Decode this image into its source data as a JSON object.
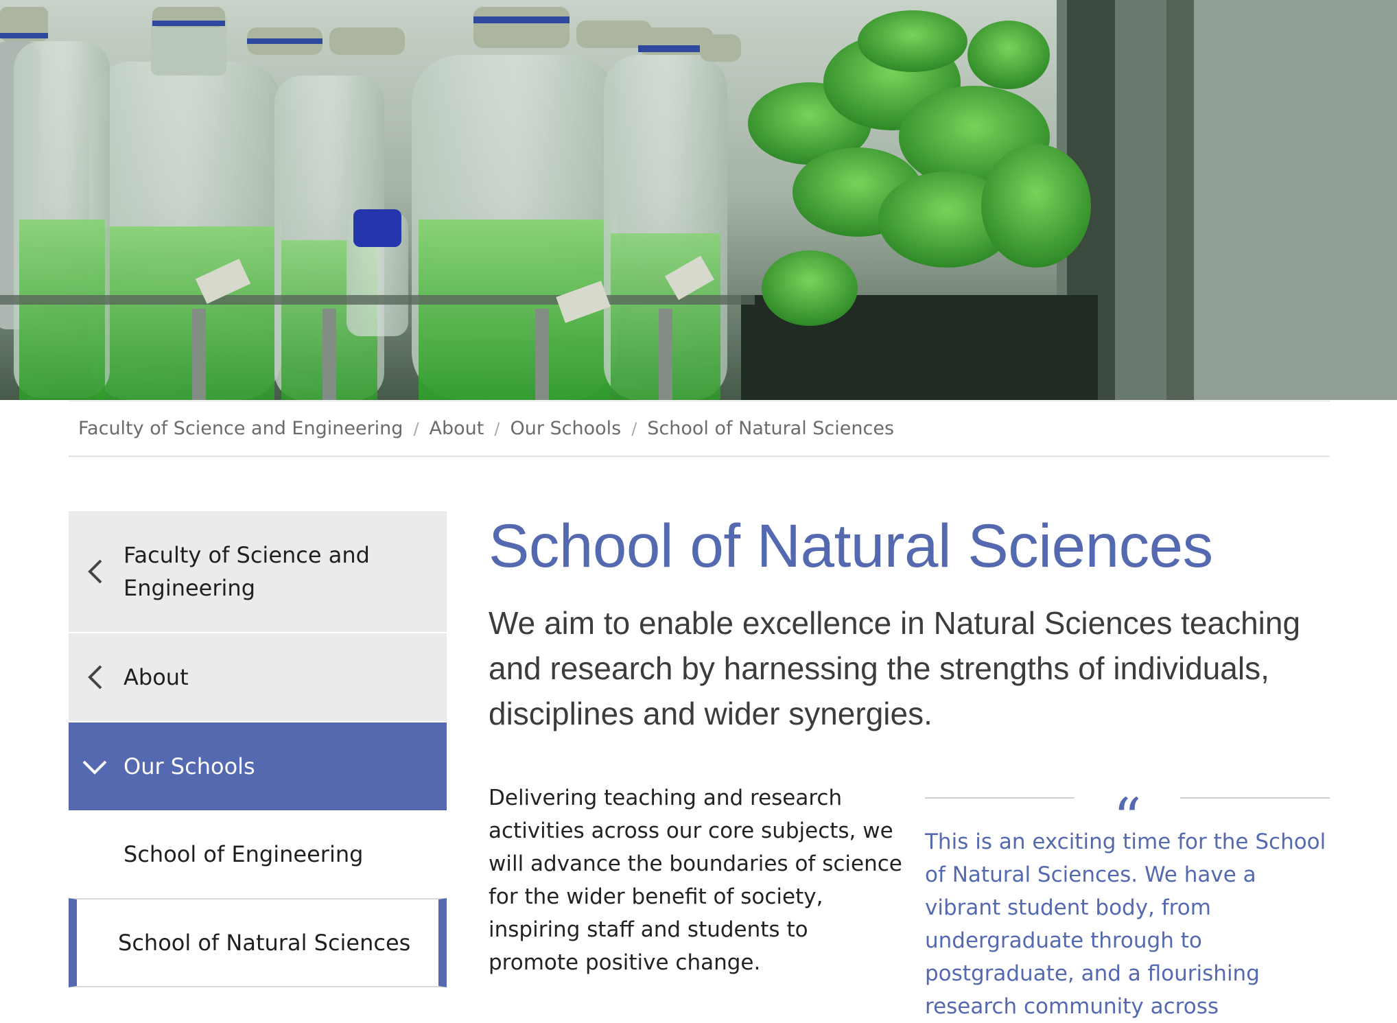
{
  "hero": {
    "image_description_icon": "lab-bottles-plants-image"
  },
  "breadcrumb": {
    "items": [
      "Faculty of Science and Engineering",
      "About",
      "Our Schools",
      "School of Natural Sciences"
    ],
    "separator": "/"
  },
  "sidebar": {
    "items": [
      {
        "label": "Faculty of Science and Engineering",
        "icon": "chevron-left-icon"
      },
      {
        "label": "About",
        "icon": "chevron-left-icon"
      },
      {
        "label": "Our Schools",
        "icon": "chevron-down-icon"
      },
      {
        "label": "School of Engineering"
      },
      {
        "label": "School of Natural Sciences"
      }
    ]
  },
  "main": {
    "title": "School of Natural Sciences",
    "intro": "We aim to enable excellence in Natural Sciences teaching and research by harnessing the strengths of individuals, disciplines and wider synergies.",
    "body": "Delivering teaching and research activities across our core subjects, we will advance the boundaries of science for the wider benefit of society, inspiring staff and students to promote positive change.",
    "quote_mark": "“",
    "quote": "This is an exciting time for the School of Natural Sciences. We have a vibrant student body, from undergraduate through to postgraduate, and a flourishing research community across"
  },
  "colors": {
    "brand": "#5469af",
    "sidebar_grey": "#ebebed",
    "breadcrumb_text": "#6b6b6b"
  }
}
